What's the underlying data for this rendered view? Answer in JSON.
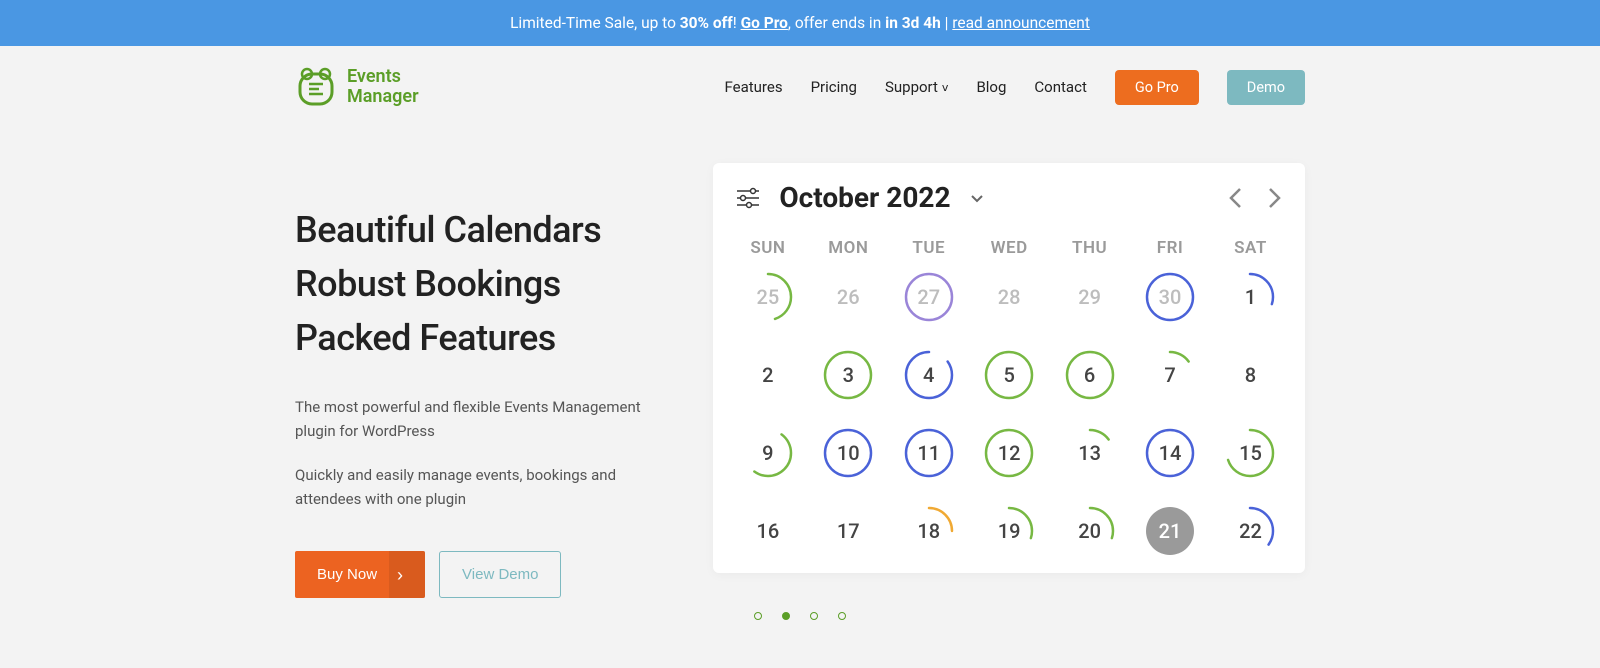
{
  "promo": {
    "prefix": "Limited-Time Sale, up to ",
    "discount": "30% off",
    "sep1": "! ",
    "go_pro": "Go Pro",
    "sep2": ", offer ends in ",
    "time": "in 3d 4h",
    "sep3": " | ",
    "announce": "read announcement"
  },
  "brand": {
    "line1": "Events",
    "line2": "Manager"
  },
  "nav": {
    "features": "Features",
    "pricing": "Pricing",
    "support": "Support",
    "blog": "Blog",
    "contact": "Contact",
    "go_pro": "Go Pro",
    "demo": "Demo"
  },
  "hero": {
    "h1a": "Beautiful Calendars",
    "h1b": "Robust Bookings",
    "h1c": "Packed Features",
    "p1": "The most powerful and flexible Events Management plugin for WordPress",
    "p2": "Quickly and easily manage events, bookings and attendees with one plugin",
    "buy": "Buy Now",
    "view_demo": "View Demo"
  },
  "calendar": {
    "title": "October 2022",
    "dow": [
      "SUN",
      "MON",
      "TUE",
      "WED",
      "THU",
      "FRI",
      "SAT"
    ],
    "weeks": [
      [
        {
          "n": "25",
          "ring": "green",
          "arc": 0.45,
          "start": 0,
          "dim": true
        },
        {
          "n": "26",
          "dim": true
        },
        {
          "n": "27",
          "ring": "purple",
          "arc": 1,
          "dim": true
        },
        {
          "n": "28",
          "dim": true
        },
        {
          "n": "29",
          "dim": true
        },
        {
          "n": "30",
          "ring": "blue",
          "arc": 1,
          "dim": true
        },
        {
          "n": "1",
          "ring": "blue",
          "arc": 0.3,
          "start": 0
        }
      ],
      [
        {
          "n": "2"
        },
        {
          "n": "3",
          "ring": "green",
          "arc": 1
        },
        {
          "n": "4",
          "ring": "blue",
          "arc": 0.85,
          "start": 0.15
        },
        {
          "n": "5",
          "ring": "green",
          "arc": 1
        },
        {
          "n": "6",
          "ring": "green",
          "arc": 1
        },
        {
          "n": "7",
          "ring": "green",
          "arc": 0.15,
          "start": 0
        },
        {
          "n": "8"
        }
      ],
      [
        {
          "n": "9",
          "ring": "green",
          "arc": 0.5,
          "start": 0.1
        },
        {
          "n": "10",
          "ring": "blue",
          "arc": 1
        },
        {
          "n": "11",
          "ring": "blue",
          "arc": 1
        },
        {
          "n": "12",
          "ring": "green",
          "arc": 1
        },
        {
          "n": "13",
          "ring": "green",
          "arc": 0.15,
          "start": 0
        },
        {
          "n": "14",
          "ring": "blue",
          "arc": 1
        },
        {
          "n": "15",
          "ring": "green",
          "arc": 0.7,
          "start": 0
        }
      ],
      [
        {
          "n": "16"
        },
        {
          "n": "17"
        },
        {
          "n": "18",
          "ring": "orange",
          "arc": 0.25,
          "start": 0
        },
        {
          "n": "19",
          "ring": "green",
          "arc": 0.3,
          "start": 0
        },
        {
          "n": "20",
          "ring": "green",
          "arc": 0.3,
          "start": 0
        },
        {
          "n": "21",
          "today": true
        },
        {
          "n": "22",
          "ring": "blue",
          "arc": 0.35,
          "start": 0
        }
      ]
    ]
  },
  "colors": {
    "green": "#77b843",
    "blue": "#4a62d8",
    "purple": "#9a85d8",
    "orange": "#f0a933"
  }
}
